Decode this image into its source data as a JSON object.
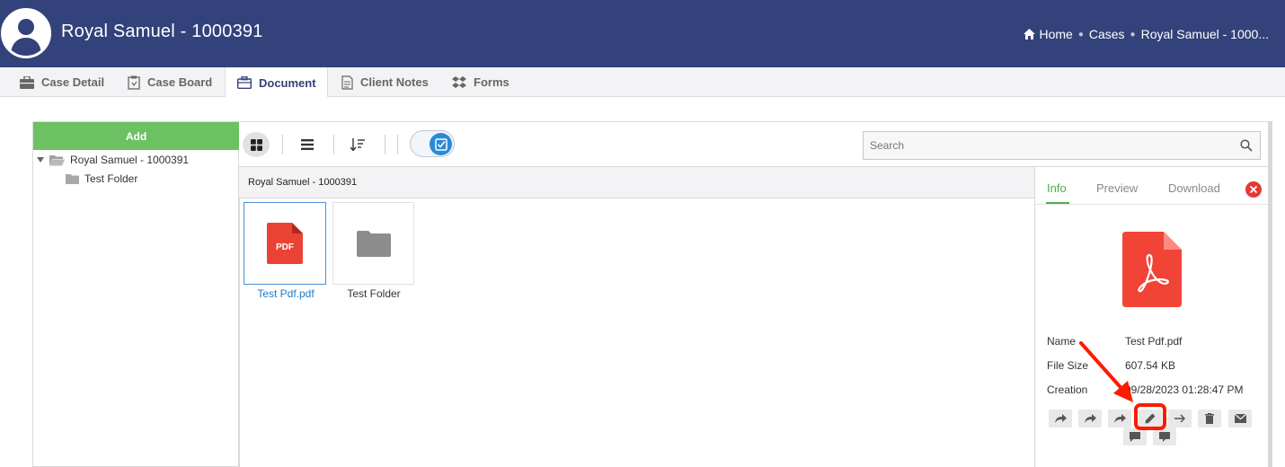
{
  "header": {
    "title": "Royal Samuel - 1000391",
    "breadcrumb": [
      {
        "label": "Home",
        "icon": "home-icon"
      },
      {
        "label": "Cases"
      },
      {
        "label": "Royal Samuel - 1000..."
      }
    ]
  },
  "tabs": [
    {
      "label": "Case Detail",
      "icon": "briefcase-icon"
    },
    {
      "label": "Case Board",
      "icon": "clipboard-icon"
    },
    {
      "label": "Document",
      "icon": "document-case-icon",
      "active": true
    },
    {
      "label": "Client Notes",
      "icon": "notes-icon"
    },
    {
      "label": "Forms",
      "icon": "forms-icon"
    }
  ],
  "left_panel": {
    "add_label": "Add",
    "tree": {
      "root": "Royal Samuel - 1000391",
      "children": [
        "Test Folder"
      ]
    }
  },
  "toolbar": {
    "search_placeholder": "Search"
  },
  "path_bar": {
    "label": "Royal Samuel - 1000391"
  },
  "files": [
    {
      "name": "Test Pdf.pdf",
      "type": "pdf",
      "badge": "PDF",
      "selected": true
    },
    {
      "name": "Test Folder",
      "type": "folder"
    }
  ],
  "info_panel": {
    "tabs": [
      "Info",
      "Preview",
      "Download"
    ],
    "active_tab": "Info",
    "fields": [
      {
        "label": "Name",
        "value": "Test Pdf.pdf"
      },
      {
        "label": "File Size",
        "value": "607.54 KB"
      },
      {
        "label": "Creation",
        "value": "09/28/2023 01:28:47 PM"
      }
    ],
    "actions": [
      "share-icon",
      "share-icon",
      "share-icon",
      "pencil-icon",
      "arrow-right-icon",
      "trash-icon",
      "mail-icon",
      "comment-icon",
      "comment-icon"
    ]
  },
  "colors": {
    "header_bg": "#33427a",
    "add_button": "#6cc163",
    "active_tab_green": "#4caf50",
    "pdf_red": "#ea4335",
    "highlight": "#ff1a00",
    "selected_text": "#1e7ac9"
  }
}
